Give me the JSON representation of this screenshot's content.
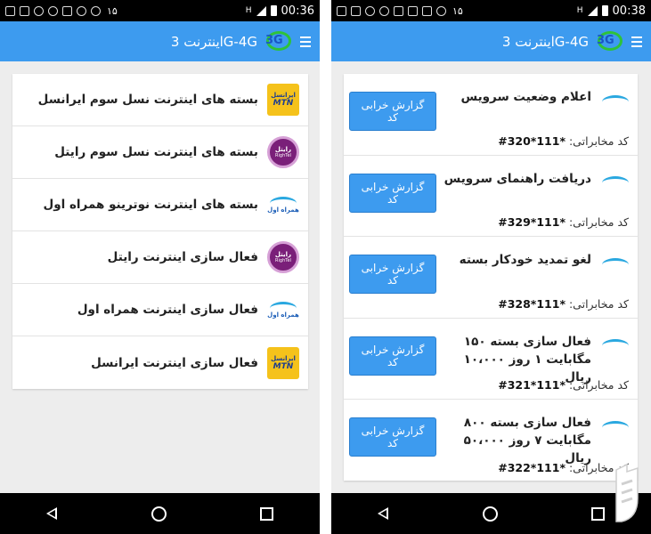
{
  "left": {
    "status": {
      "notif_count": "۱۵",
      "net": "H",
      "time": "00:36"
    },
    "appbar": {
      "title": "اینترنت 3G-4G",
      "logo_text": "3G"
    },
    "items": [
      {
        "label": "بسته های اینترنت نسل سوم ایرانسل",
        "operator": "irancell",
        "logo_top": "ایرانسل",
        "logo_bottom": "MTN"
      },
      {
        "label": "بسته های اینترنت نسل سوم  رایتل",
        "operator": "rightel",
        "logo_top": "رایتل",
        "logo_bottom": "RighTel"
      },
      {
        "label": "بسته های اینترنت نوترینو همراه اول",
        "operator": "mci",
        "logo_top": "همراه اول"
      },
      {
        "label": "فعال سازی اینترنت رایتل",
        "operator": "rightel",
        "logo_top": "رایتل",
        "logo_bottom": "RighTel"
      },
      {
        "label": "فعال سازی اینترنت همراه اول",
        "operator": "mci",
        "logo_top": "همراه اول"
      },
      {
        "label": "فعال سازی اینترنت ایرانسل",
        "operator": "irancell",
        "logo_top": "ایرانسل",
        "logo_bottom": "MTN"
      }
    ]
  },
  "right": {
    "status": {
      "notif_count": "۱۵",
      "net": "H",
      "time": "00:38"
    },
    "appbar": {
      "title": "اینترنت 3G-4G",
      "logo_text": "3G"
    },
    "code_label": "کد مخابراتی:",
    "report_label": "گزارش خرابی کد",
    "services": [
      {
        "title": "اعلام وضعیت سرویس",
        "code": "*111*320#"
      },
      {
        "title": "دریافت راهنمای سرویس",
        "code": "*111*329#"
      },
      {
        "title": "لغو تمدید خودکار بسته",
        "code": "*111*328#"
      },
      {
        "title": "فعال سازی بسته ۱۵۰ مگابایت ۱ روز ۱۰،۰۰۰ ریال",
        "code": "*111*321#"
      },
      {
        "title": "فعال سازی بسته ۸۰۰ مگابایت ۷ روز ۵۰،۰۰۰ ریال",
        "code": "*111*322#"
      }
    ]
  },
  "colors": {
    "appbar": "#3d9bef",
    "button": "#3d9bef",
    "statusbar": "#000000"
  }
}
